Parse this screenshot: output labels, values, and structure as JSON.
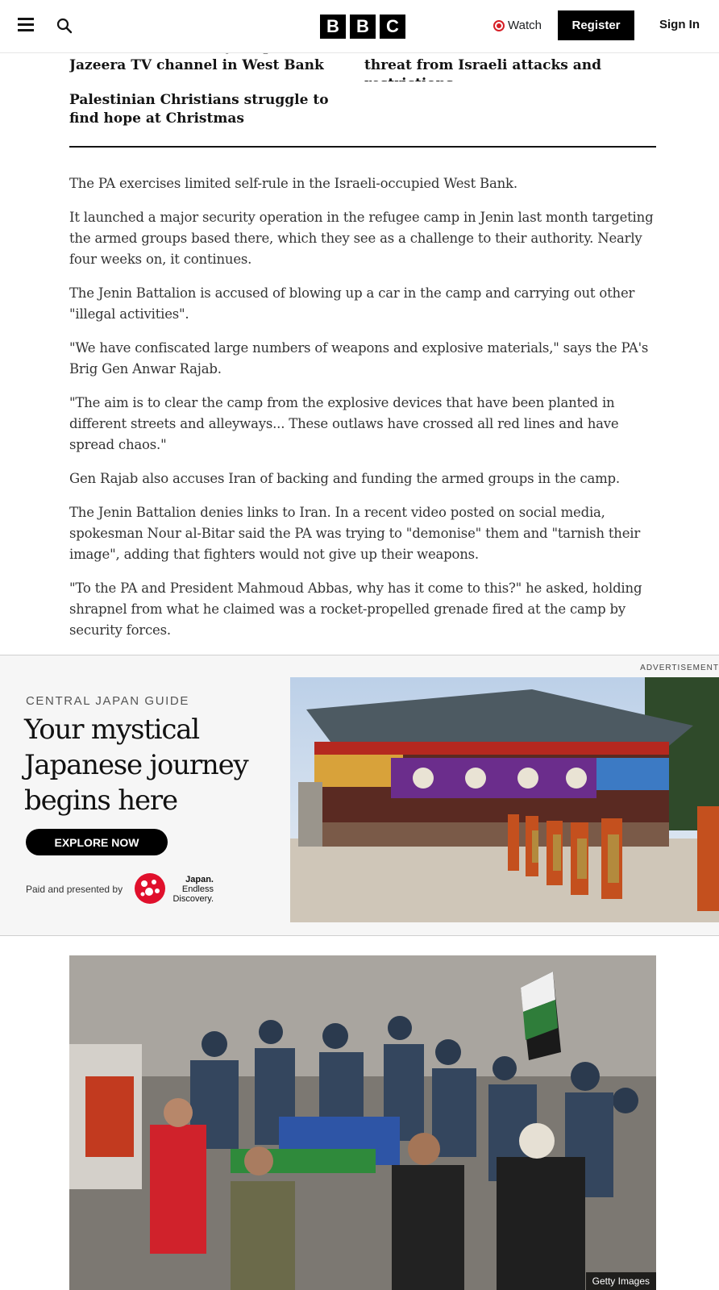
{
  "header": {
    "logo_letters": [
      "B",
      "B",
      "C"
    ],
    "watch_label": "Watch",
    "register_label": "Register",
    "signin_label": "Sign In"
  },
  "related": {
    "links": [
      "Palestinian Authority suspends Al Jazeera TV channel in West Bank",
      "Palestinian olive harvest under threat from Israeli attacks and restrictions",
      "Palestinian Christians struggle to find hope at Christmas"
    ]
  },
  "article": {
    "paragraphs": [
      "The PA exercises limited self-rule in the Israeli-occupied West Bank.",
      "It launched a major security operation in the refugee camp in Jenin last month targeting the armed groups based there, which they see as a challenge to their authority. Nearly four weeks on, it continues.",
      "The Jenin Battalion is accused of blowing up a car in the camp and carrying out other \"illegal activities\".",
      "\"We have confiscated large numbers of weapons and explosive materials,\" says the PA's Brig Gen Anwar Rajab.",
      "\"The aim is to clear the camp from the explosive devices that have been planted in different streets and alleyways... These outlaws have crossed all red lines and have spread chaos.\"",
      "Gen Rajab also accuses Iran of backing and funding the armed groups in the camp.",
      "The Jenin Battalion denies links to Iran. In a recent video posted on social media, spokesman Nour al-Bitar said the PA was trying to \"demonise\" them and \"tarnish their image\", adding that fighters would not give up their weapons.",
      "\"To the PA and President Mahmoud Abbas, why has it come to this?\" he asked, holding shrapnel from what he claimed was a rocket-propelled grenade fired at the camp by security forces."
    ]
  },
  "ad": {
    "label": "ADVERTISEMENT",
    "kicker": "CENTRAL JAPAN GUIDE",
    "headline": "Your mystical Japanese journey begins here",
    "button": "EXPLORE NOW",
    "paid_text": "Paid and presented by",
    "sponsor_line1": "Japan.",
    "sponsor_line2": "Endless",
    "sponsor_line3": "Discovery."
  },
  "photo": {
    "credit": "Getty Images"
  },
  "colors": {
    "brand_black": "#000000",
    "watch_red": "#d61f26",
    "ad_background": "#f6f6f6"
  }
}
